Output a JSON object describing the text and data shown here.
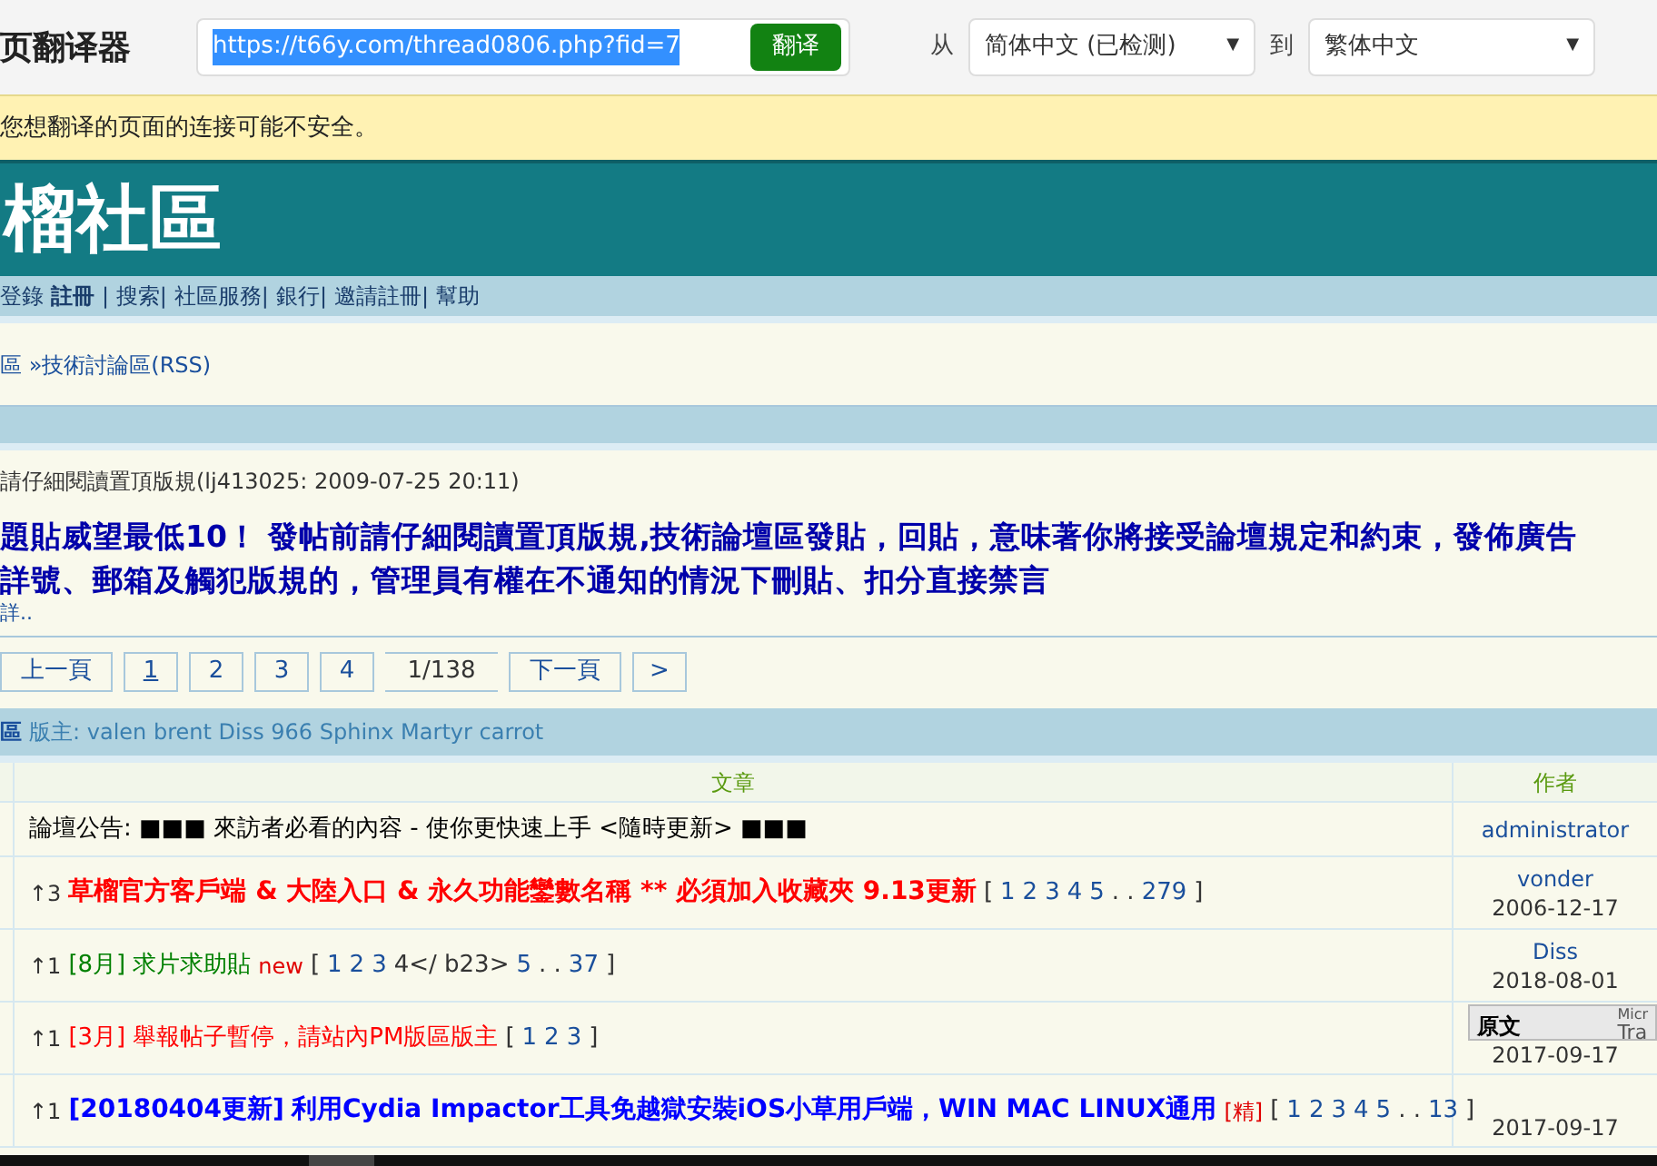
{
  "translator": {
    "title": "页翻译器",
    "url": "https://t66y.com/thread0806.php?fid=7",
    "url_selected": true,
    "translate_button": "翻译",
    "from_label": "从",
    "from_language": "简体中文 (已检测)",
    "to_label": "到",
    "to_language": "繁体中文",
    "caret": "▼"
  },
  "warning": "您想翻译的页面的连接可能不安全。",
  "site": {
    "logo": "榴社區",
    "nav": [
      {
        "label": "登錄",
        "bold": false
      },
      {
        "label": "註冊",
        "bold": true
      },
      {
        "label": "| 搜索|",
        "bold": false
      },
      {
        "label": "社區服務|",
        "bold": false
      },
      {
        "label": "銀行|",
        "bold": false
      },
      {
        "label": "邀請註冊|",
        "bold": false
      },
      {
        "label": "幫助",
        "bold": false
      }
    ],
    "breadcrumb": [
      "區 »",
      "技術討論區",
      "(RSS)"
    ],
    "notice_meta": "請仔細閱讀置頂版規(lj413025: 2009-07-25 20:11)",
    "notice_lines": [
      "題貼威望最低10！ 發帖前請仔細閱讀置頂版規,技術論壇區發貼，回貼，意味著你將接受論壇規定和約束，發佈廣告",
      "詳號、郵箱及觸犯版規的，管理員有權在不通知的情況下刪貼、扣分直接禁言"
    ],
    "notice_more": "詳..",
    "pagination": [
      {
        "label": "上一頁",
        "selected": false
      },
      {
        "label": "1",
        "selected": true
      },
      {
        "label": "2",
        "selected": false
      },
      {
        "label": "3",
        "selected": false
      },
      {
        "label": "4",
        "selected": false
      },
      {
        "label": "1/138",
        "kind": "info",
        "selected": false
      },
      {
        "label": "下一頁",
        "selected": false
      },
      {
        "label": ">",
        "selected": false
      }
    ],
    "forum_bar": {
      "name": "區",
      "moderators": "版主: valen brent Diss 966 Sphinx Martyr carrot"
    },
    "table": {
      "columns": [
        "文章",
        "作者"
      ],
      "rows": [
        {
          "prefix": "",
          "title": "論壇公告: ■■■ 來訪者必看的內容 - 使你更快速上手 <隨時更新> ■■■",
          "color": "#000000",
          "bold": false,
          "flag": "",
          "pages": [],
          "author": "administrator",
          "date": ""
        },
        {
          "prefix": "↑3",
          "title": "草榴官方客戶端 & 大陸入口 & 永久功能鑾數名稱 ** 必須加入收藏夾 9.13更新",
          "color": "#ff0000",
          "bold": true,
          "flag": "",
          "pages": [
            {
              "label": "[",
              "link": false
            },
            {
              "label": "1",
              "link": true
            },
            {
              "label": "2",
              "link": true
            },
            {
              "label": "3",
              "link": true
            },
            {
              "label": "4",
              "link": true
            },
            {
              "label": "5",
              "link": true
            },
            {
              "label": ". .",
              "link": false
            },
            {
              "label": "279",
              "link": true
            },
            {
              "label": "]",
              "link": false
            }
          ],
          "author": "vonder",
          "date": "2006-12-17"
        },
        {
          "prefix": "↑1",
          "tag": "[8月]",
          "title": "求片求助貼",
          "color": "#008000",
          "bold": false,
          "flag": "new",
          "pages": [
            {
              "label": "[",
              "link": false
            },
            {
              "label": "1",
              "link": true
            },
            {
              "label": "2",
              "link": true
            },
            {
              "label": "3",
              "link": true
            },
            {
              "label": "4</ b23>",
              "link": false
            },
            {
              "label": "5",
              "link": true
            },
            {
              "label": ". .",
              "link": false
            },
            {
              "label": "37",
              "link": true
            },
            {
              "label": "]",
              "link": false
            }
          ],
          "author": "Diss",
          "date": "2018-08-01"
        },
        {
          "prefix": "↑1",
          "tag": "[3月]",
          "title": "舉報帖子暫停，請站內PM版區版主",
          "color": "#ff0000",
          "bold": false,
          "flag": "",
          "pages": [
            {
              "label": "[",
              "link": false
            },
            {
              "label": "1",
              "link": true
            },
            {
              "label": "2",
              "link": true
            },
            {
              "label": "3",
              "link": true
            },
            {
              "label": "]",
              "link": false
            }
          ],
          "author": "",
          "date": "2017-09-17"
        },
        {
          "prefix": "↑1",
          "tag": "[20180404更新]",
          "title": "利用Cydia Impactor工具免越獄安裝iOS小草用戶端，WIN MAC LINUX通用",
          "color": "#0000ff",
          "bold": true,
          "flag": "[精]",
          "pages": [
            {
              "label": "[",
              "link": false
            },
            {
              "label": "1",
              "link": true
            },
            {
              "label": "2",
              "link": true
            },
            {
              "label": "3",
              "link": true
            },
            {
              "label": "4",
              "link": true
            },
            {
              "label": "5",
              "link": true
            },
            {
              "label": ". .",
              "link": false
            },
            {
              "label": "13",
              "link": true
            },
            {
              "label": "]",
              "link": false
            }
          ],
          "author": "",
          "date": "2017-09-17"
        }
      ]
    },
    "popup": {
      "title": "原文",
      "side_top": "Micr",
      "side_bottom": "Tra"
    }
  }
}
